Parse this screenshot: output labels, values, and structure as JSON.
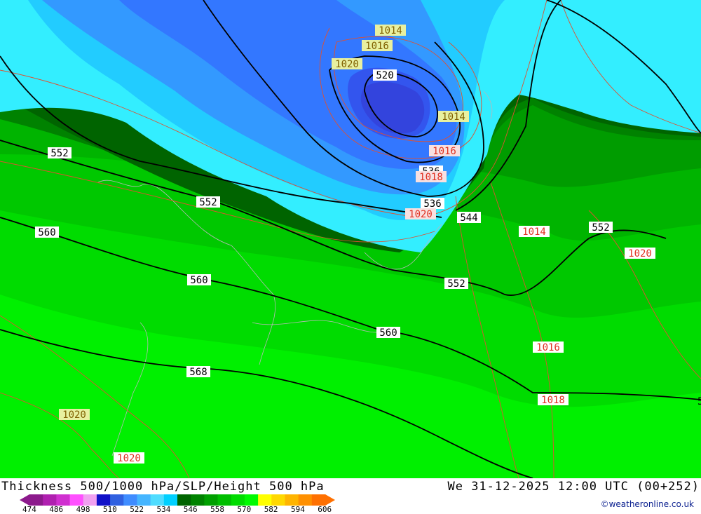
{
  "title": "Thickness 500/1000 hPa/SLP/Height 500 hPa",
  "datetime": "We 31-12-2025 12:00 UTC (00+252)",
  "credit": "©weatheronline.co.uk",
  "legend": {
    "ticks": [
      "474",
      "486",
      "498",
      "510",
      "522",
      "534",
      "546",
      "558",
      "570",
      "582",
      "594",
      "606"
    ],
    "colors": [
      "#8c1a8c",
      "#b020b0",
      "#d030d0",
      "#ff50ff",
      "#f0a0f0",
      "#1010c8",
      "#3060e0",
      "#3f8cff",
      "#45b5ff",
      "#4fdcff",
      "#00d0ff",
      "#006400",
      "#008200",
      "#00a000",
      "#00be00",
      "#00dc00",
      "#00fa00",
      "#ffff00",
      "#ffd800",
      "#ffb400",
      "#ff9000",
      "#ff7000"
    ]
  },
  "map": {
    "colors": {
      "cyan": "#33eeff",
      "light_blue": "#22ccff",
      "blue": "#3399ff",
      "mid_blue": "#3377ff",
      "deep_blue": "#3355ee",
      "dark_green": "#006e00",
      "green1": "#008c00",
      "green2": "#00a000",
      "green3": "#00b400",
      "green4": "#00c800",
      "green5": "#00dc00",
      "green6": "#00f000",
      "height_contour": "#000000",
      "slp_contour": "#e05030",
      "coast": "#b8b8b8"
    },
    "height_labels": [
      "552",
      "552",
      "560",
      "560",
      "568",
      "520",
      "536",
      "544",
      "552",
      "552",
      "560",
      "536"
    ],
    "slp_labels": [
      "1014",
      "1016",
      "1020",
      "1014",
      "1016",
      "1018",
      "1020",
      "1014",
      "1020",
      "1016",
      "1018",
      "1020",
      "1020"
    ]
  }
}
